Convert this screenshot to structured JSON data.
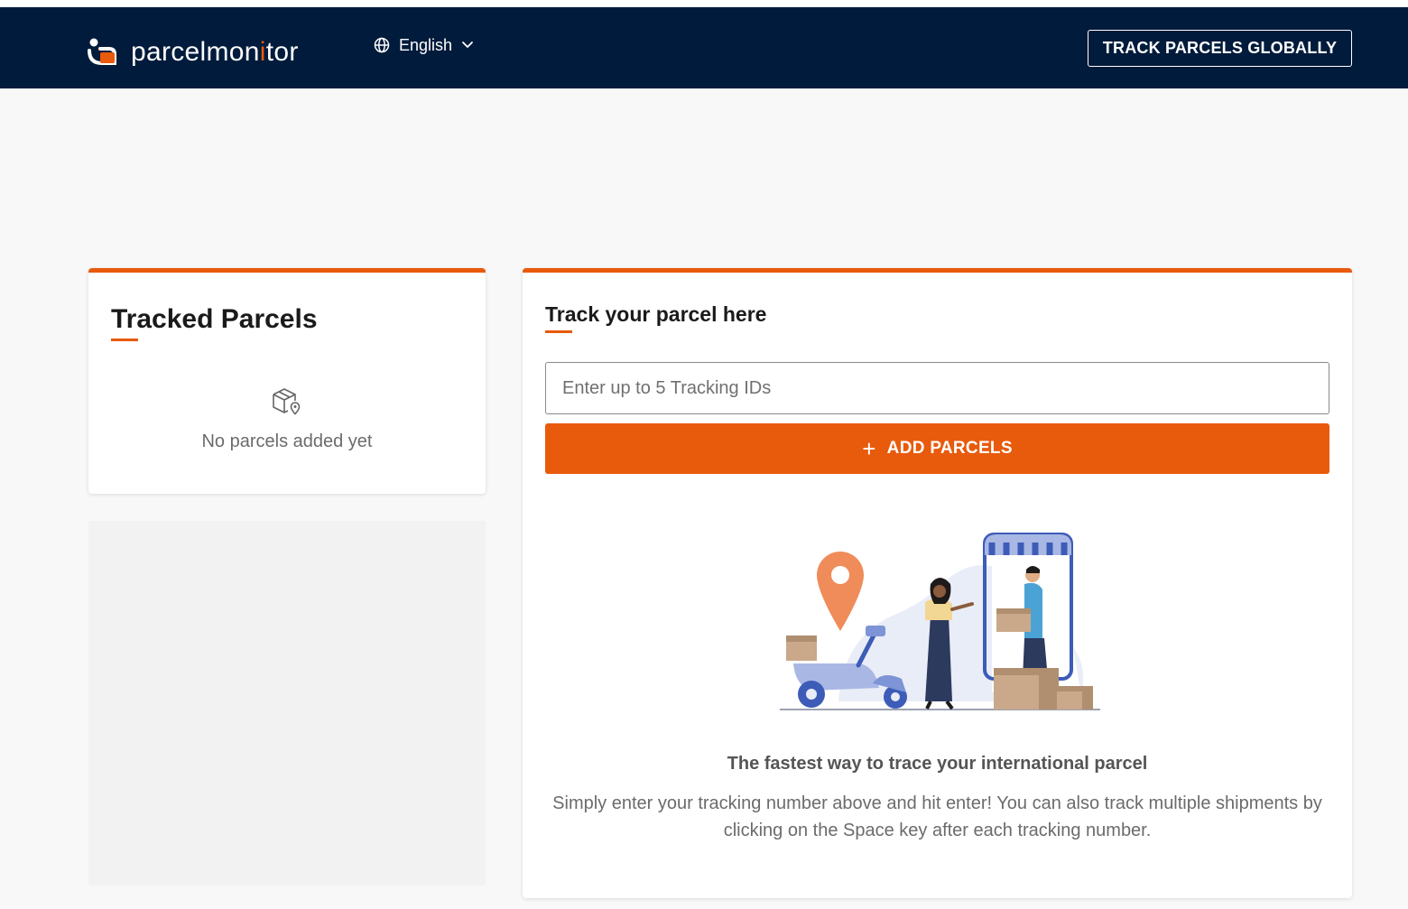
{
  "header": {
    "logo_text_prefix": "parcelmon",
    "logo_text_dot": "i",
    "logo_text_suffix": "tor",
    "language": "English",
    "track_global_label": "TRACK PARCELS GLOBALLY"
  },
  "tracked": {
    "title": "Tracked Parcels",
    "empty_text": "No parcels added yet"
  },
  "tracker": {
    "title": "Track your parcel here",
    "input_placeholder": "Enter up to 5 Tracking IDs",
    "input_value": "",
    "add_label": "ADD PARCELS",
    "tagline": "The fastest way to trace your international parcel",
    "description": "Simply enter your tracking number above and hit enter! You can also track multiple shipments by clicking on the Space key after each tracking number."
  },
  "icons": {
    "language": "globe-icon",
    "dropdown": "chevron-down-icon",
    "empty": "package-location-icon",
    "add": "plus-icon"
  },
  "colors": {
    "header_bg": "#001b3b",
    "accent": "#e85a0c",
    "page_bg": "#f8f8f8"
  }
}
